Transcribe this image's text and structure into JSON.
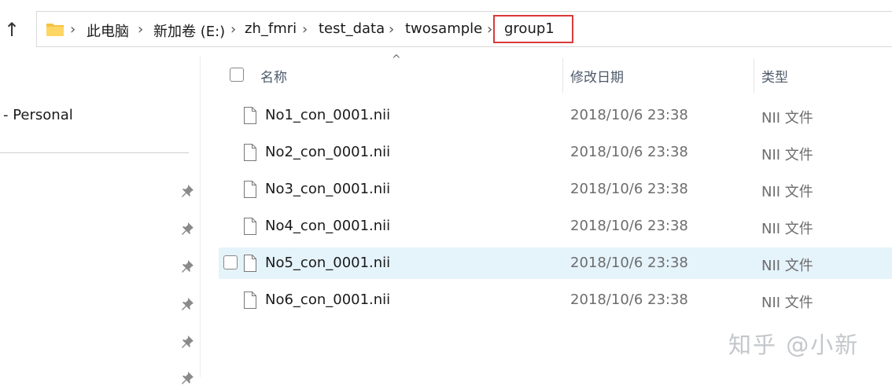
{
  "toolbar": {
    "up_glyph": "↑"
  },
  "address_bar": {
    "separator": "›",
    "crumbs": [
      "此电脑",
      "新加卷 (E:)",
      "zh_fmri",
      "test_data",
      "twosample",
      "group1"
    ]
  },
  "nav": {
    "personal_label": "- Personal"
  },
  "columns": {
    "name": "名称",
    "date": "修改日期",
    "type": "类型",
    "sort_glyph": "^"
  },
  "files": [
    {
      "name": "No1_con_0001.nii",
      "date": "2018/10/6 23:38",
      "type": "NII 文件"
    },
    {
      "name": "No2_con_0001.nii",
      "date": "2018/10/6 23:38",
      "type": "NII 文件"
    },
    {
      "name": "No3_con_0001.nii",
      "date": "2018/10/6 23:38",
      "type": "NII 文件"
    },
    {
      "name": "No4_con_0001.nii",
      "date": "2018/10/6 23:38",
      "type": "NII 文件"
    },
    {
      "name": "No5_con_0001.nii",
      "date": "2018/10/6 23:38",
      "type": "NII 文件"
    },
    {
      "name": "No6_con_0001.nii",
      "date": "2018/10/6 23:38",
      "type": "NII 文件"
    }
  ],
  "watermark": "知乎 @小新",
  "colors": {
    "highlight_box": "#d93a3a",
    "selected_row": "#e5f3fb",
    "folder": "#f5c242"
  }
}
